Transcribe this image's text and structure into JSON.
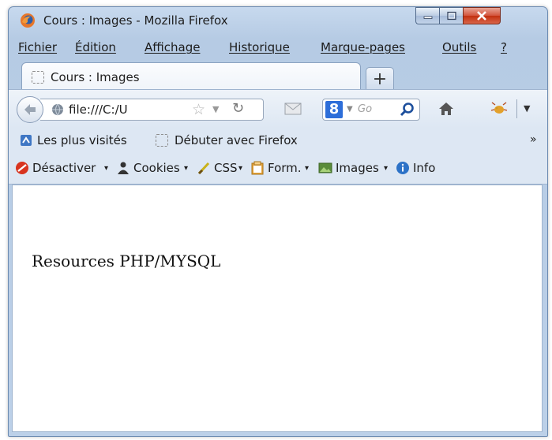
{
  "window": {
    "title": "Cours : Images - Mozilla Firefox"
  },
  "menu": {
    "items": [
      "Fichier",
      "Édition",
      "Affichage",
      "Historique",
      "Marque-pages",
      "Outils",
      "?"
    ]
  },
  "tab": {
    "label": "Cours : Images",
    "new_tab": "+"
  },
  "navigation": {
    "url": "file:///C:/U",
    "search_placeholder": "Go",
    "search_engine": "8"
  },
  "bookmarks": {
    "items": [
      "Les plus visités",
      "Débuter avec Firefox"
    ],
    "overflow": "»"
  },
  "developer_toolbar": {
    "items": [
      "Désactiver",
      "Cookies",
      "CSS",
      "Form.",
      "Images",
      "Info"
    ]
  },
  "page": {
    "content_text": "Resources PHP/MYSQL"
  },
  "colors": {
    "chrome": "#c7d9ee",
    "close_button": "#c2300f",
    "search_engine": "#2d6ed9"
  }
}
